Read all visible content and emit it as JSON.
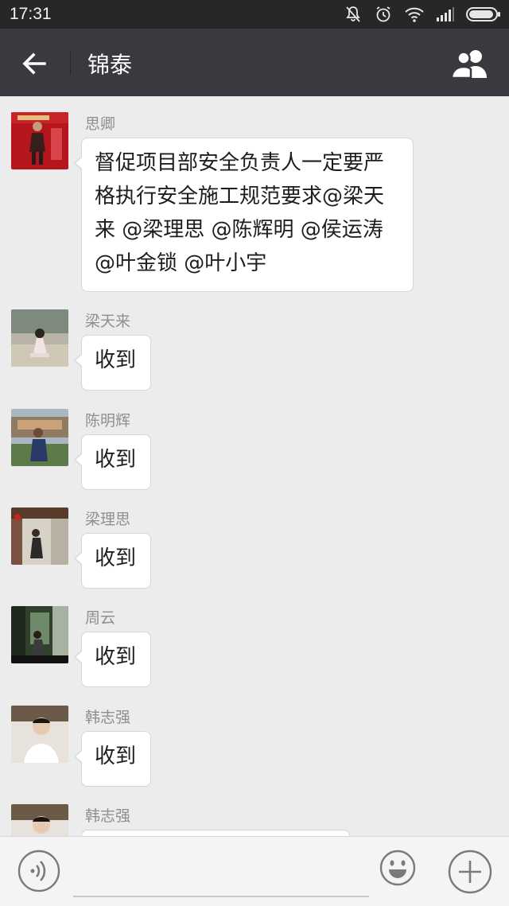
{
  "status_bar": {
    "time": "17:31",
    "icons": [
      "notifications-off-icon",
      "alarm-icon",
      "wifi-icon",
      "signal-icon",
      "battery-icon"
    ]
  },
  "header": {
    "title": "锦泰",
    "back_icon": "arrow-left-icon",
    "members_icon": "group-members-icon"
  },
  "messages": [
    {
      "sender": "思卿",
      "text": "督促项目部安全负责人一定要严格执行安全施工规范要求@梁天来 @梁理思 @陈辉明 @侯运涛 @叶金锁 @叶小宇"
    },
    {
      "sender": "梁天来",
      "text": "收到"
    },
    {
      "sender": "陈明辉",
      "text": "收到"
    },
    {
      "sender": "梁理思",
      "text": "收到"
    },
    {
      "sender": "周云",
      "text": "收到"
    },
    {
      "sender": "韩志强",
      "text": "收到"
    },
    {
      "sender": "韩志强",
      "text": ""
    }
  ],
  "input_bar": {
    "voice_icon": "voice-input-icon",
    "text_value": "",
    "emoji_icon": "emoji-icon",
    "more_icon": "plus-icon"
  },
  "colors": {
    "status_bar_bg": "#262729",
    "title_bar_bg": "#393a3f",
    "chat_bg": "#ececec",
    "bubble_bg": "#ffffff",
    "sender_text": "#8f8f8f"
  }
}
